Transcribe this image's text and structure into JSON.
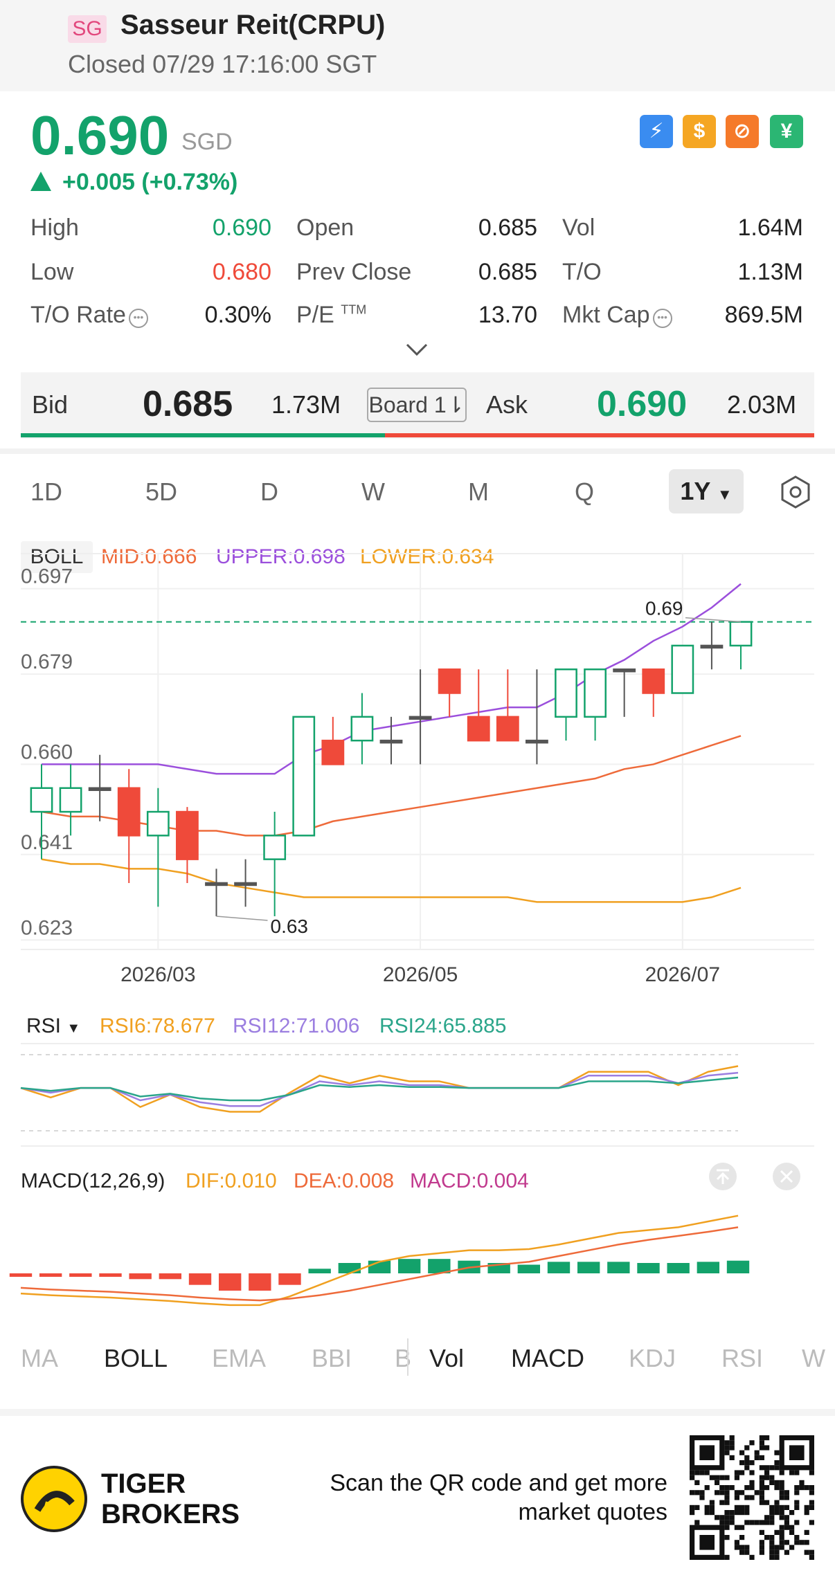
{
  "header": {
    "market_badge": "SG",
    "title": "Sasseur Reit(CRPU)",
    "status": "Closed 07/29 17:16:00 SGT"
  },
  "quote": {
    "price": "0.690",
    "currency": "SGD",
    "change": "+0.005 (+0.73%)",
    "color_up": "#13a26b",
    "color_down": "#ef4a3a"
  },
  "stats": {
    "high_label": "High",
    "high_value": "0.690",
    "low_label": "Low",
    "low_value": "0.680",
    "to_rate_label": "T/O Rate",
    "to_rate_value": "0.30%",
    "open_label": "Open",
    "open_value": "0.685",
    "prev_close_label": "Prev Close",
    "prev_close_value": "0.685",
    "pe_label": "P/E",
    "pe_suffix": "TTM",
    "pe_value": "13.70",
    "vol_label": "Vol",
    "vol_value": "1.64M",
    "to_label": "T/O",
    "to_value": "1.13M",
    "mktcap_label": "Mkt Cap",
    "mktcap_value": "869.5M"
  },
  "order_book": {
    "bid_label": "Bid",
    "bid_price": "0.685",
    "bid_size": "1.73M",
    "board_label": "Board 1⇂",
    "ask_label": "Ask",
    "ask_price": "0.690",
    "ask_size": "2.03M"
  },
  "period_tabs": [
    "1D",
    "5D",
    "D",
    "W",
    "M",
    "Q"
  ],
  "period_selected": "1Y",
  "chart_data": [
    {
      "type": "candlestick",
      "indicator": "BOLL",
      "legend": {
        "mid": "MID:0.666",
        "upper": "UPPER:0.698",
        "lower": "LOWER:0.634"
      },
      "y_ticks": [
        "0.697",
        "0.679",
        "0.660",
        "0.641",
        "0.623"
      ],
      "ylim": [
        0.621,
        0.7
      ],
      "x_ticks": [
        "2026/03",
        "2026/05",
        "2026/07"
      ],
      "annotations": {
        "high": "0.69",
        "low": "0.63"
      },
      "last_price_line": 0.69,
      "candles": [
        {
          "o": 0.65,
          "h": 0.66,
          "l": 0.64,
          "c": 0.655
        },
        {
          "o": 0.65,
          "h": 0.66,
          "l": 0.645,
          "c": 0.655
        },
        {
          "o": 0.655,
          "h": 0.662,
          "l": 0.648,
          "c": 0.655
        },
        {
          "o": 0.655,
          "h": 0.659,
          "l": 0.635,
          "c": 0.645
        },
        {
          "o": 0.645,
          "h": 0.655,
          "l": 0.63,
          "c": 0.65
        },
        {
          "o": 0.65,
          "h": 0.651,
          "l": 0.635,
          "c": 0.64
        },
        {
          "o": 0.635,
          "h": 0.638,
          "l": 0.628,
          "c": 0.635
        },
        {
          "o": 0.635,
          "h": 0.64,
          "l": 0.63,
          "c": 0.635
        },
        {
          "o": 0.64,
          "h": 0.65,
          "l": 0.628,
          "c": 0.645
        },
        {
          "o": 0.645,
          "h": 0.67,
          "l": 0.645,
          "c": 0.67
        },
        {
          "o": 0.665,
          "h": 0.67,
          "l": 0.66,
          "c": 0.66
        },
        {
          "o": 0.665,
          "h": 0.675,
          "l": 0.66,
          "c": 0.67
        },
        {
          "o": 0.665,
          "h": 0.67,
          "l": 0.66,
          "c": 0.665
        },
        {
          "o": 0.67,
          "h": 0.68,
          "l": 0.66,
          "c": 0.67
        },
        {
          "o": 0.68,
          "h": 0.68,
          "l": 0.67,
          "c": 0.675
        },
        {
          "o": 0.67,
          "h": 0.68,
          "l": 0.665,
          "c": 0.665
        },
        {
          "o": 0.67,
          "h": 0.68,
          "l": 0.665,
          "c": 0.665
        },
        {
          "o": 0.665,
          "h": 0.68,
          "l": 0.66,
          "c": 0.665
        },
        {
          "o": 0.67,
          "h": 0.68,
          "l": 0.665,
          "c": 0.68
        },
        {
          "o": 0.67,
          "h": 0.68,
          "l": 0.665,
          "c": 0.68
        },
        {
          "o": 0.68,
          "h": 0.68,
          "l": 0.67,
          "c": 0.68
        },
        {
          "o": 0.68,
          "h": 0.68,
          "l": 0.67,
          "c": 0.675
        },
        {
          "o": 0.675,
          "h": 0.685,
          "l": 0.675,
          "c": 0.685
        },
        {
          "o": 0.685,
          "h": 0.69,
          "l": 0.68,
          "c": 0.685
        },
        {
          "o": 0.685,
          "h": 0.69,
          "l": 0.68,
          "c": 0.69
        }
      ],
      "boll_upper": [
        0.66,
        0.66,
        0.66,
        0.66,
        0.66,
        0.659,
        0.658,
        0.658,
        0.658,
        0.662,
        0.664,
        0.667,
        0.668,
        0.669,
        0.67,
        0.671,
        0.672,
        0.672,
        0.675,
        0.679,
        0.682,
        0.686,
        0.689,
        0.693,
        0.698
      ],
      "boll_mid": [
        0.65,
        0.649,
        0.649,
        0.648,
        0.647,
        0.646,
        0.646,
        0.645,
        0.645,
        0.646,
        0.648,
        0.649,
        0.65,
        0.651,
        0.652,
        0.653,
        0.654,
        0.655,
        0.656,
        0.657,
        0.659,
        0.66,
        0.662,
        0.664,
        0.666
      ],
      "boll_lower": [
        0.64,
        0.639,
        0.639,
        0.638,
        0.638,
        0.637,
        0.635,
        0.634,
        0.633,
        0.632,
        0.632,
        0.632,
        0.632,
        0.632,
        0.632,
        0.632,
        0.632,
        0.631,
        0.631,
        0.631,
        0.631,
        0.631,
        0.631,
        0.632,
        0.634
      ]
    },
    {
      "type": "line",
      "indicator": "RSI",
      "legend": {
        "rsi6": "RSI6:78.677",
        "rsi12": "RSI12:71.006",
        "rsi24": "RSI24:65.885"
      },
      "ylim": [
        0,
        100
      ],
      "series": [
        {
          "name": "RSI6",
          "values": [
            55,
            45,
            55,
            55,
            35,
            48,
            35,
            30,
            30,
            50,
            68,
            60,
            68,
            62,
            62,
            55,
            55,
            55,
            55,
            72,
            72,
            72,
            58,
            72,
            78
          ]
        },
        {
          "name": "RSI12",
          "values": [
            55,
            50,
            55,
            55,
            42,
            48,
            40,
            36,
            36,
            48,
            62,
            58,
            62,
            58,
            58,
            55,
            55,
            55,
            55,
            68,
            68,
            68,
            60,
            68,
            71
          ]
        },
        {
          "name": "RSI24",
          "values": [
            55,
            52,
            55,
            55,
            46,
            49,
            44,
            42,
            42,
            48,
            58,
            56,
            58,
            56,
            56,
            55,
            55,
            55,
            55,
            62,
            62,
            62,
            60,
            63,
            66
          ]
        }
      ]
    },
    {
      "type": "bar+line",
      "indicator": "MACD",
      "legend": {
        "name": "MACD(12,26,9)",
        "dif": "DIF:0.010",
        "dea": "DEA:0.008",
        "macd": "MACD:0.004"
      },
      "ylim": [
        -0.006,
        0.012
      ],
      "dif": [
        -0.0035,
        -0.0038,
        -0.004,
        -0.0042,
        -0.0045,
        -0.0048,
        -0.0052,
        -0.0055,
        -0.0055,
        -0.004,
        -0.002,
        0.0,
        0.002,
        0.003,
        0.0035,
        0.004,
        0.004,
        0.0042,
        0.005,
        0.006,
        0.007,
        0.0075,
        0.008,
        0.009,
        0.01
      ],
      "dea": [
        -0.0025,
        -0.0028,
        -0.003,
        -0.0032,
        -0.0035,
        -0.0038,
        -0.0042,
        -0.0045,
        -0.0047,
        -0.0044,
        -0.0038,
        -0.003,
        -0.002,
        -0.001,
        0.0,
        0.001,
        0.0015,
        0.002,
        0.003,
        0.004,
        0.005,
        0.0058,
        0.0065,
        0.0072,
        0.008
      ],
      "macd": [
        -0.0006,
        -0.0006,
        -0.0006,
        -0.0006,
        -0.001,
        -0.001,
        -0.002,
        -0.003,
        -0.003,
        -0.002,
        0.0008,
        0.0018,
        0.0022,
        0.0025,
        0.0025,
        0.0022,
        0.0018,
        0.0015,
        0.002,
        0.002,
        0.002,
        0.0018,
        0.0018,
        0.002,
        0.0022
      ]
    }
  ],
  "indicator_tabs_main": [
    "MA",
    "BOLL",
    "EMA",
    "BBI",
    "B"
  ],
  "indicator_tabs_sub": [
    "Vol",
    "MACD",
    "KDJ",
    "RSI",
    "W"
  ],
  "main_indicator_active": "BOLL",
  "footer": {
    "brand_line1": "TIGER",
    "brand_line2": "BROKERS",
    "scan_text": "Scan the QR code and get more market quotes"
  },
  "colors": {
    "up": "#13a26b",
    "down": "#ef4a3a",
    "upper": "#9b4fdc",
    "mid": "#ee6a3a",
    "lower": "#f0a020",
    "rsi6": "#f0a020",
    "rsi12": "#9b7ee0",
    "rsi24": "#2aa58a",
    "dif": "#f0a020",
    "dea": "#ee6a3a",
    "macd": "#c13a8e"
  }
}
